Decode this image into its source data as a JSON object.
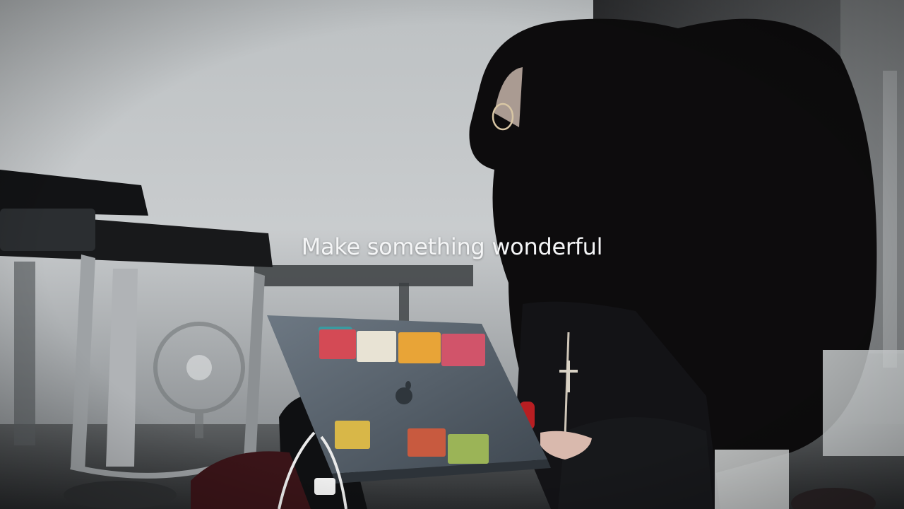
{
  "caption": {
    "text": "Make something wonderful"
  },
  "scene": {
    "description_icons": [
      "chair-icon",
      "laptop-icon",
      "apple-logo-icon",
      "person-icon",
      "fan-icon",
      "cable-icon"
    ],
    "colors": {
      "wall": "#c9ccce",
      "floor": "#3a3c3e",
      "laptop": "#5c6772",
      "hair": "#0d0c0d",
      "chair_seat": "#111214"
    }
  }
}
